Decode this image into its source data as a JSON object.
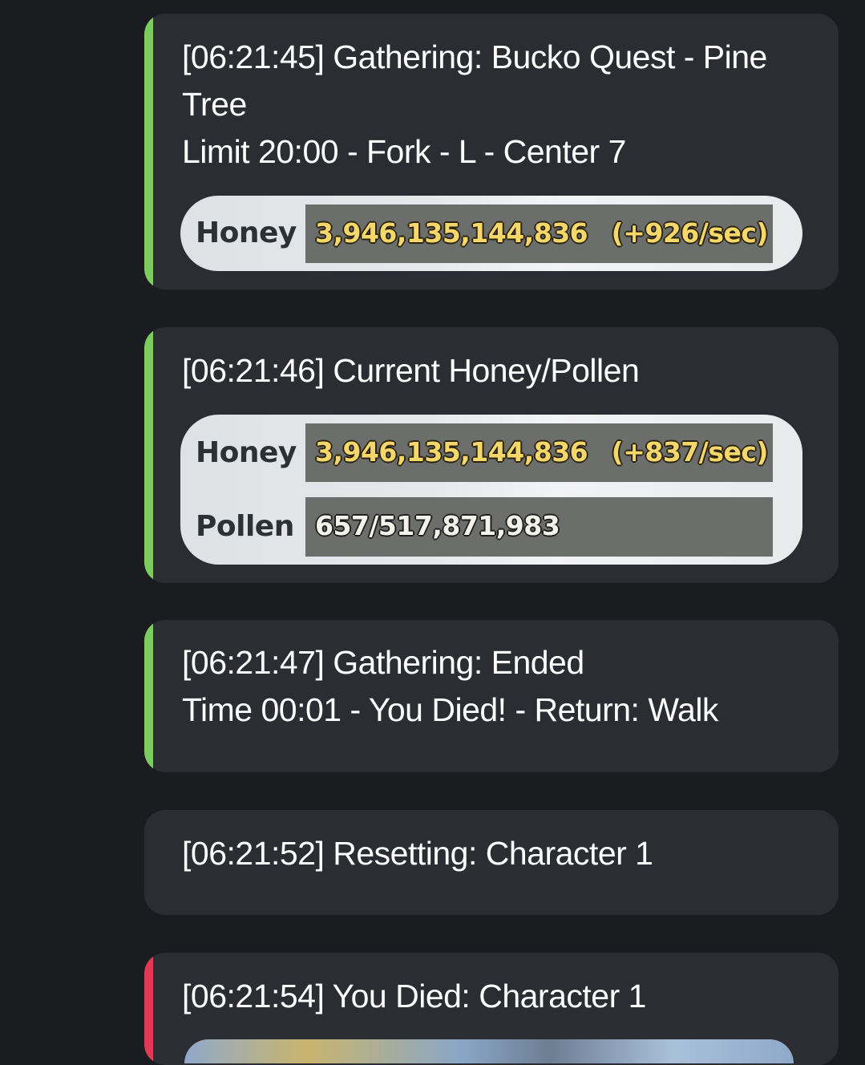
{
  "colors": {
    "background": "#1b1c20",
    "embed_bg": "#2b2d33",
    "accent_green": "#7dcc5e",
    "accent_red": "#e23a54",
    "honey_text": "#f5d76a"
  },
  "messages": [
    {
      "lines": [
        "[06:21:45] Gathering: Bucko Quest - Pine",
        "Tree",
        "Limit 20:00 - Fork - L - Center 7"
      ],
      "accent": "green",
      "stats": {
        "honey_label": "Honey",
        "honey_value": "3,946,135,144,836",
        "honey_rate": "(+926/sec)"
      }
    },
    {
      "lines": [
        "[06:21:46] Current Honey/Pollen"
      ],
      "accent": "green",
      "stats": {
        "honey_label": "Honey",
        "honey_value": "3,946,135,144,836",
        "honey_rate": "(+837/sec)",
        "pollen_label": "Pollen",
        "pollen_value": "657/517,871,983"
      }
    },
    {
      "lines": [
        "[06:21:47] Gathering: Ended",
        "Time 00:01 - You Died! - Return: Walk"
      ],
      "accent": "green"
    },
    {
      "lines": [
        "[06:21:52] Resetting: Character 1"
      ],
      "accent": "none"
    },
    {
      "lines": [
        "[06:21:54] You Died: Character 1"
      ],
      "accent": "red"
    }
  ]
}
